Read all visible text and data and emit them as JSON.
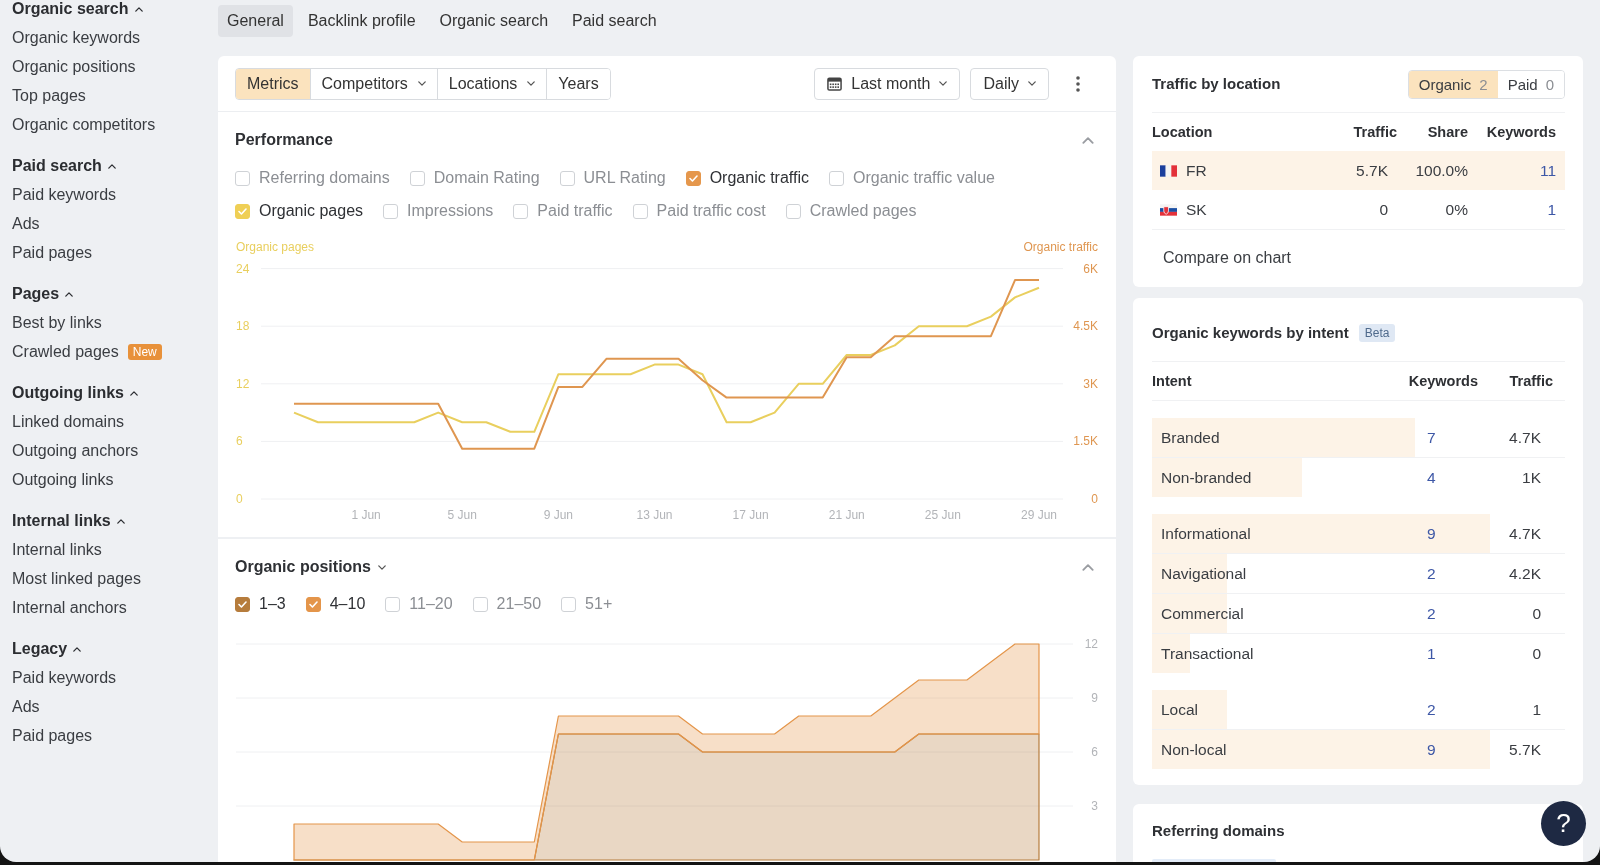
{
  "sidebar": {
    "sections": [
      {
        "title": "Organic search",
        "expanded": true,
        "items": [
          {
            "label": "Organic keywords"
          },
          {
            "label": "Organic positions"
          },
          {
            "label": "Top pages"
          },
          {
            "label": "Organic competitors"
          }
        ]
      },
      {
        "title": "Paid search",
        "expanded": true,
        "items": [
          {
            "label": "Paid keywords"
          },
          {
            "label": "Ads"
          },
          {
            "label": "Paid pages"
          }
        ]
      },
      {
        "title": "Pages",
        "expanded": true,
        "items": [
          {
            "label": "Best by links"
          },
          {
            "label": "Crawled pages",
            "badge": "New"
          }
        ]
      },
      {
        "title": "Outgoing links",
        "expanded": true,
        "items": [
          {
            "label": "Linked domains"
          },
          {
            "label": "Outgoing anchors"
          },
          {
            "label": "Outgoing links"
          }
        ]
      },
      {
        "title": "Internal links",
        "expanded": true,
        "items": [
          {
            "label": "Internal links"
          },
          {
            "label": "Most linked pages"
          },
          {
            "label": "Internal anchors"
          }
        ]
      },
      {
        "title": "Legacy",
        "expanded": true,
        "items": [
          {
            "label": "Paid keywords"
          },
          {
            "label": "Ads"
          },
          {
            "label": "Paid pages"
          }
        ]
      }
    ]
  },
  "tabs": [
    {
      "label": "General",
      "selected": true
    },
    {
      "label": "Backlink profile",
      "selected": false
    },
    {
      "label": "Organic search",
      "selected": false
    },
    {
      "label": "Paid search",
      "selected": false
    }
  ],
  "toolbar": {
    "segments": [
      {
        "label": "Metrics",
        "selected": true,
        "dropdown": false
      },
      {
        "label": "Competitors",
        "selected": false,
        "dropdown": true
      },
      {
        "label": "Locations",
        "selected": false,
        "dropdown": true
      },
      {
        "label": "Years",
        "selected": false,
        "dropdown": false
      }
    ],
    "date_range": {
      "label": "Last month"
    },
    "interval": {
      "label": "Daily"
    }
  },
  "performance": {
    "title": "Performance",
    "expanded": true,
    "metric_rows": [
      {
        "items": [
          {
            "label": "Referring domains",
            "checked": false
          },
          {
            "label": "Domain Rating",
            "checked": false
          },
          {
            "label": "URL Rating",
            "checked": false
          },
          {
            "label": "Organic traffic",
            "checked": true,
            "color": "#e5974c"
          },
          {
            "label": "Organic traffic value",
            "checked": false
          }
        ]
      },
      {
        "items": [
          {
            "label": "Organic pages",
            "checked": true,
            "color": "#efcf55"
          },
          {
            "label": "Impressions",
            "checked": false
          },
          {
            "label": "Paid traffic",
            "checked": false
          },
          {
            "label": "Paid traffic cost",
            "checked": false
          },
          {
            "label": "Crawled pages",
            "checked": false
          }
        ]
      }
    ],
    "chart_data": {
      "type": "line",
      "grid": true,
      "categories": [
        null,
        null,
        null,
        "1 Jun",
        null,
        null,
        null,
        "5 Jun",
        null,
        null,
        null,
        "9 Jun",
        null,
        null,
        null,
        "13 Jun",
        null,
        null,
        null,
        "17 Jun",
        null,
        null,
        null,
        "21 Jun",
        null,
        null,
        null,
        "25 Jun",
        null,
        null,
        null,
        "29 Jun"
      ],
      "ylim": [
        0,
        24
      ],
      "yticks": [
        0,
        6,
        12,
        18,
        24
      ],
      "y2lim": [
        0,
        6000
      ],
      "y2ticks": [
        {
          "value": 0,
          "label": "0"
        },
        {
          "value": 1500,
          "label": "1.5K"
        },
        {
          "value": 3000,
          "label": "3K"
        },
        {
          "value": 4500,
          "label": "4.5K"
        },
        {
          "value": 6000,
          "label": "6K"
        }
      ],
      "series": [
        {
          "name": "Organic pages",
          "color": "#e9cf5e",
          "values": [
            9,
            8,
            8,
            8,
            8,
            8,
            9,
            8,
            8,
            7,
            7,
            13,
            13,
            13,
            13,
            14,
            14,
            13,
            8,
            8,
            9,
            12,
            12,
            15,
            15,
            16,
            18,
            18,
            18,
            19,
            21,
            22
          ]
        },
        {
          "name": "Organic traffic",
          "color": "#df9650",
          "axis": "y2",
          "values": [
            2480,
            2480,
            2480,
            2480,
            2480,
            2480,
            2480,
            1310,
            1310,
            1310,
            1310,
            2920,
            2920,
            3650,
            3650,
            3650,
            3650,
            3090,
            2640,
            2640,
            2640,
            2640,
            2640,
            3690,
            3690,
            4240,
            4240,
            4240,
            4240,
            4240,
            5700,
            5700
          ]
        }
      ]
    }
  },
  "organic_positions": {
    "title": "Organic positions",
    "expanded": true,
    "filters": [
      {
        "label": "1–3",
        "checked": true,
        "color": "#b67c3c"
      },
      {
        "label": "4–10",
        "checked": true,
        "color": "#e4954a"
      },
      {
        "label": "11–20",
        "checked": false
      },
      {
        "label": "21–50",
        "checked": false
      },
      {
        "label": "51+",
        "checked": false
      }
    ],
    "chart_data": {
      "type": "area",
      "stacked": true,
      "grid": true,
      "ylim": [
        0,
        12
      ],
      "yticks": [
        3,
        6,
        9,
        12
      ],
      "series": [
        {
          "color": "#b67c3c",
          "values": [
            0,
            0,
            0,
            0,
            0,
            0,
            0,
            0,
            0,
            0,
            0,
            7,
            7,
            7,
            7,
            7,
            7,
            6,
            6,
            6,
            6,
            6,
            6,
            6,
            6,
            6,
            7,
            7,
            7,
            7,
            7,
            7
          ]
        },
        {
          "color": "#e4954a",
          "values": [
            2,
            2,
            2,
            2,
            2,
            2,
            2,
            1,
            1,
            1,
            1,
            1,
            1,
            1,
            1,
            1,
            1,
            1,
            1,
            1,
            1,
            2,
            2,
            2,
            2,
            3,
            3,
            3,
            3,
            4,
            5,
            5
          ]
        }
      ]
    }
  },
  "traffic_by_location": {
    "title": "Traffic by location",
    "toggle": [
      {
        "label": "Organic",
        "count": "2",
        "selected": true
      },
      {
        "label": "Paid",
        "count": "0",
        "selected": false
      }
    ],
    "columns": [
      "Location",
      "Traffic",
      "Share",
      "Keywords"
    ],
    "rows": [
      {
        "kind": "france",
        "location": "FR",
        "traffic": "5.7K",
        "share": "100.0%",
        "keywords": "11",
        "level": 1
      },
      {
        "kind": "slovakia",
        "location": "SK",
        "traffic": "0",
        "share": "0%",
        "keywords": "1"
      }
    ],
    "link": "Compare on chart"
  },
  "keywords_by_intent": {
    "title": "Organic keywords by intent",
    "badge": "Beta",
    "columns": [
      "Intent",
      "Keywords",
      "Traffic"
    ],
    "groups": [
      {
        "rows": [
          {
            "intent": "Branded",
            "keywords": "7",
            "traffic": "4.7K",
            "level": 0.636
          },
          {
            "intent": "Non-branded",
            "keywords": "4",
            "traffic": "1K",
            "level": 0.364
          }
        ]
      },
      {
        "rows": [
          {
            "intent": "Informational",
            "keywords": "9",
            "traffic": "4.7K",
            "level": 0.818
          },
          {
            "intent": "Navigational",
            "keywords": "2",
            "traffic": "4.2K",
            "level": 0.182
          },
          {
            "intent": "Commercial",
            "keywords": "2",
            "traffic": "0",
            "level": 0.182
          },
          {
            "intent": "Transactional",
            "keywords": "1",
            "traffic": "0",
            "level": 0.091
          }
        ]
      },
      {
        "rows": [
          {
            "intent": "Local",
            "keywords": "2",
            "traffic": "1",
            "level": 0.182
          },
          {
            "intent": "Non-local",
            "keywords": "9",
            "traffic": "5.7K",
            "level": 0.818
          }
        ]
      }
    ]
  },
  "referring_domains": {
    "title": "Referring domains"
  },
  "help_button": {
    "label": "?"
  }
}
